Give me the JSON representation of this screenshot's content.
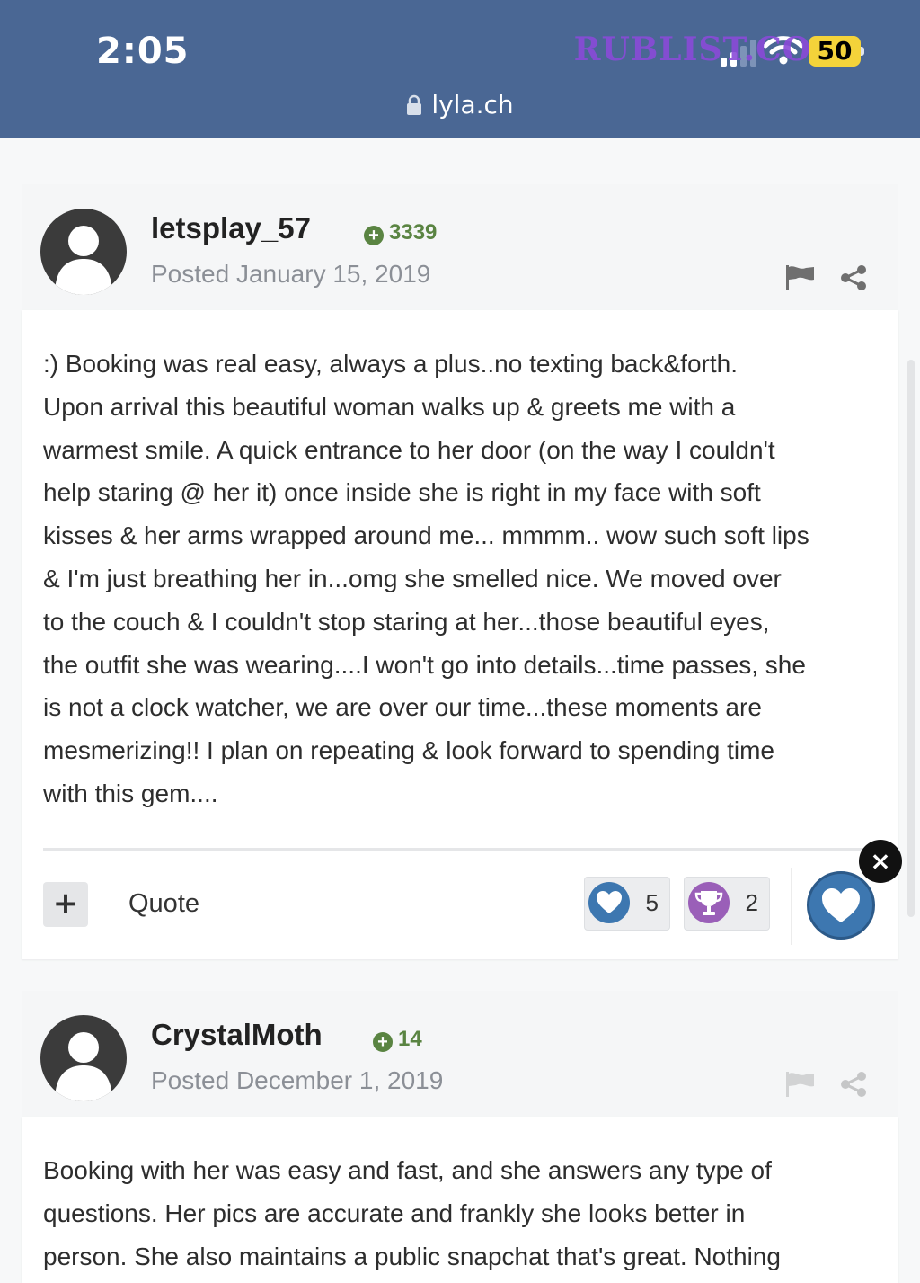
{
  "status_bar": {
    "time": "2:05",
    "url": "lyla.ch",
    "battery": "50",
    "watermark": "RUBLIST.COM",
    "battery_color": "#f4d33a"
  },
  "posts": [
    {
      "author": "letsplay_57",
      "reputation": "3339",
      "posted": "Posted January 15, 2019",
      "body": ":) Booking was real easy, always a plus..no texting back&forth.  \nUpon arrival this beautiful woman walks up  & greets me with a \nwarmest smile. A quick entrance to her door (on the way I couldn't \nhelp staring @ her it) once inside she is right in my face with soft \nkisses & her arms wrapped around me... mmmm.. wow such soft lips \n& I'm just breathing her in...omg she smelled nice.  We moved over \nto the couch & I couldn't stop staring at her...those beautiful eyes, \nthe outfit she was wearing....I won't go into details...time passes, she \nis not a clock watcher, we are over our time...these moments are \nmesmerizing!! I plan on repeating & look forward to spending time \nwith this gem....",
      "actions": {
        "add_label": "+",
        "quote_label": "Quote",
        "like_count": "5",
        "trophy_count": "2"
      }
    },
    {
      "author": "CrystalMoth",
      "reputation": "14",
      "posted": "Posted December 1, 2019",
      "body": "Booking with her was easy and fast, and she answers any type of \nquestions.  Her pics are accurate and frankly she looks better in \nperson. She also maintains a public snapchat that's great.  Nothing"
    }
  ],
  "overlay": {
    "close_label": "×"
  },
  "colors": {
    "header_bg": "#4a6794",
    "reputation_green": "#5a8442",
    "like_blue": "#3d77b0",
    "trophy_purple": "#9a5fb8"
  }
}
